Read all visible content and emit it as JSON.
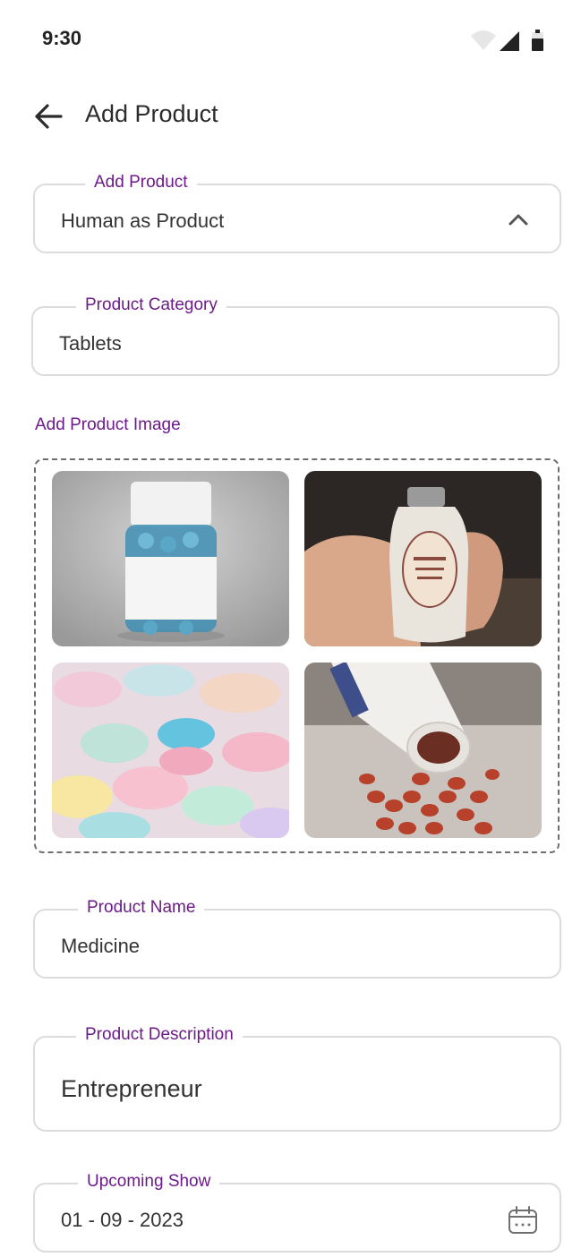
{
  "status": {
    "time": "9:30"
  },
  "header": {
    "title": "Add Product"
  },
  "form": {
    "product_type": {
      "label": "Add Product",
      "value": "Human as Product"
    },
    "category": {
      "label": "Product Category",
      "value": "Tablets"
    },
    "images": {
      "label": "Add Product Image",
      "items": [
        "pill-bottle-image",
        "hand-holding-bottle-image",
        "colorful-tablets-image",
        "spilled-pills-image"
      ]
    },
    "name": {
      "label": "Product Name",
      "value": "Medicine"
    },
    "description": {
      "label": "Product Description",
      "value": "Entrepreneur"
    },
    "upcoming_show": {
      "label": "Upcoming Show",
      "value": "01 - 09 - 2023"
    }
  },
  "colors": {
    "accent": "#6d1a8a",
    "border": "#dcdcdc"
  }
}
